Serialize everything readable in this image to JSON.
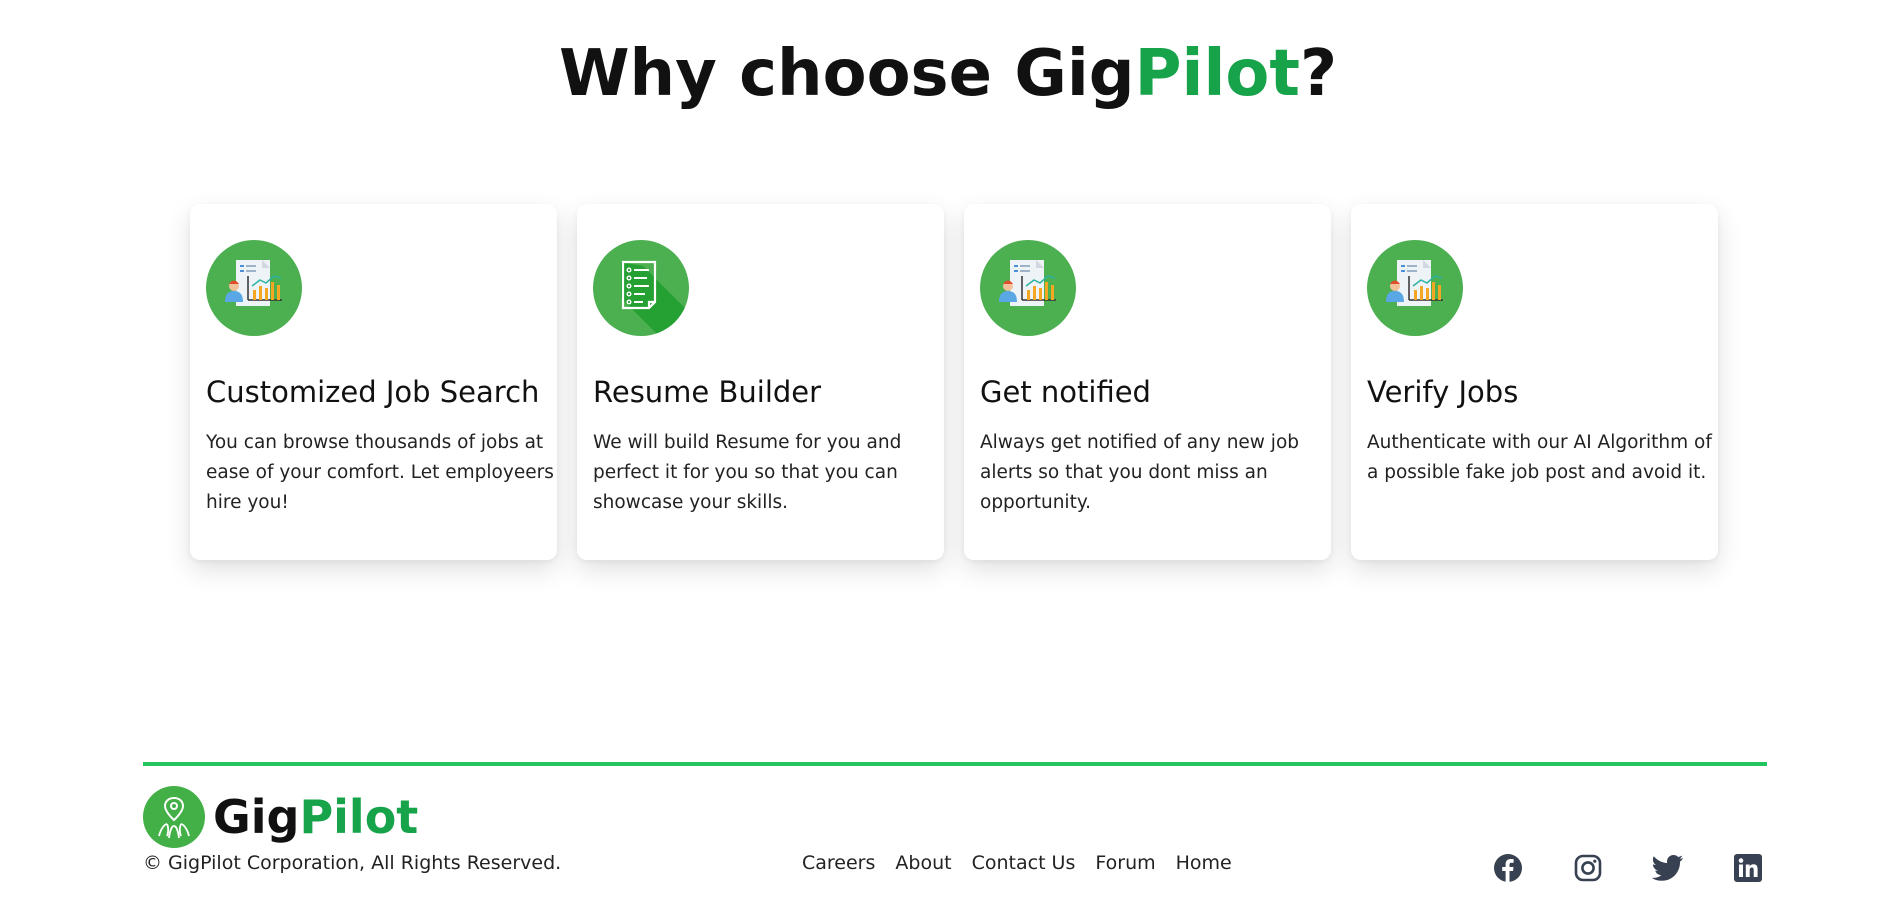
{
  "heading": {
    "prefix": "Why choose Gig",
    "accent": "Pilot",
    "suffix": "?"
  },
  "features": [
    {
      "icon": "analytics-report-icon",
      "title": "Customized Job Search",
      "description": "You can browse thousands of jobs at ease of your comfort. Let employeers hire you!"
    },
    {
      "icon": "resume-document-icon",
      "title": "Resume Builder",
      "description": "We will build Resume for you and perfect it for you so that you can showcase your skills."
    },
    {
      "icon": "analytics-report-icon",
      "title": "Get notified",
      "description": "Always get notified of any new job alerts so that you dont miss an opportunity."
    },
    {
      "icon": "analytics-report-icon",
      "title": "Verify Jobs",
      "description": "Authenticate with our AI Algorithm of a possible fake job post and avoid it."
    }
  ],
  "footer": {
    "logo": {
      "prefix": "Gig",
      "accent": "Pilot"
    },
    "copyright": "© GigPilot Corporation, All Rights Reserved.",
    "nav": [
      "Careers",
      "About",
      "Contact Us",
      "Forum",
      "Home"
    ],
    "social": [
      "facebook-icon",
      "instagram-icon",
      "twitter-icon",
      "linkedin-icon"
    ]
  },
  "colors": {
    "accent": "#16a34a",
    "icon_circle": "#4caf50",
    "footer_line": "#22c55e",
    "social_icon": "#374151"
  }
}
